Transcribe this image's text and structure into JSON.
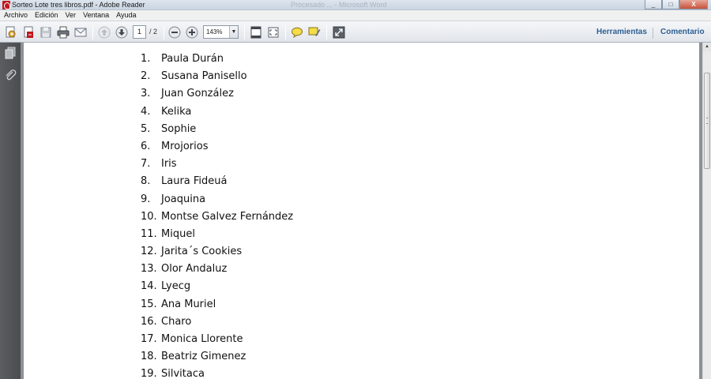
{
  "window": {
    "title": "Sorteo Lote tres libros.pdf - Adobe Reader",
    "ghost_title": "Procesado ...  -  Microsoft Word",
    "minimize_glyph": "_",
    "maximize_glyph": "□",
    "close_glyph": "X"
  },
  "menu": [
    "Archivo",
    "Edición",
    "Ver",
    "Ventana",
    "Ayuda"
  ],
  "toolbar": {
    "page_current": "1",
    "page_total": "/ 2",
    "zoom": "143%",
    "zoom_arrow": "▼",
    "tools_label": "Herramientas",
    "comment_label": "Comentario"
  },
  "document": {
    "items": [
      {
        "num": "1.",
        "name": "Paula Durán"
      },
      {
        "num": "2.",
        "name": "Susana Panisello"
      },
      {
        "num": "3.",
        "name": "Juan González"
      },
      {
        "num": "4.",
        "name": "Kelika"
      },
      {
        "num": "5.",
        "name": "Sophie"
      },
      {
        "num": "6.",
        "name": "Mrojorios"
      },
      {
        "num": "7.",
        "name": "Iris"
      },
      {
        "num": "8.",
        "name": "Laura Fideuá"
      },
      {
        "num": "9.",
        "name": "Joaquina"
      },
      {
        "num": "10.",
        "name": "Montse Galvez Fernández"
      },
      {
        "num": "11.",
        "name": "Miquel"
      },
      {
        "num": "12.",
        "name": "Jarita´s Cookies"
      },
      {
        "num": "13.",
        "name": "Olor Andaluz"
      },
      {
        "num": "14.",
        "name": "Lyecg"
      },
      {
        "num": "15.",
        "name": "Ana Muriel"
      },
      {
        "num": "16.",
        "name": "Charo"
      },
      {
        "num": "17.",
        "name": "Monica Llorente"
      },
      {
        "num": "18.",
        "name": "Beatriz Gimenez"
      },
      {
        "num": "19.",
        "name": "Silvitaca"
      }
    ]
  },
  "colors": {
    "accent_link": "#2d5f95",
    "nav_pane": "#4a4c4f",
    "app_red": "#c0181e"
  }
}
